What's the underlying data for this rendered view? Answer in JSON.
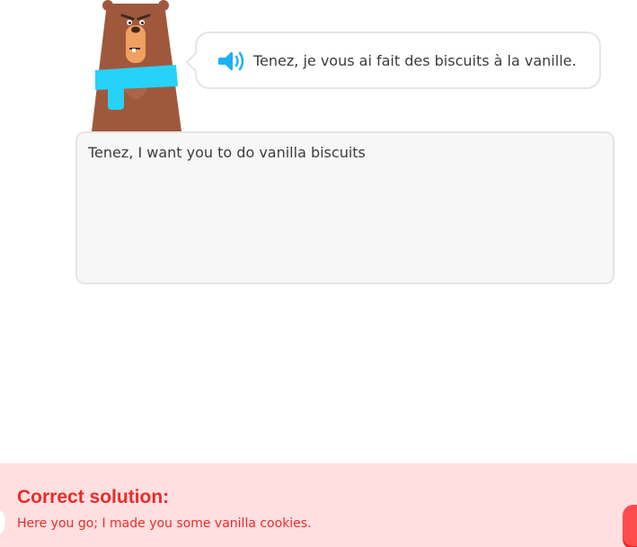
{
  "prompt": {
    "sentence": "Tenez, je vous ai fait des biscuits à la vanille.",
    "speaker_icon": "speaker-icon"
  },
  "answer": {
    "value": "Tenez, I want you to do vanilla biscuits"
  },
  "feedback": {
    "title": "Correct solution:",
    "solution": "Here you go; I made you some vanilla cookies."
  },
  "colors": {
    "accent_blue": "#1cb0f6",
    "error_red": "#ea2b2b",
    "error_bg": "#ffdfe0",
    "bear_brown": "#a0583c",
    "scarf_cyan": "#27d2f8"
  }
}
